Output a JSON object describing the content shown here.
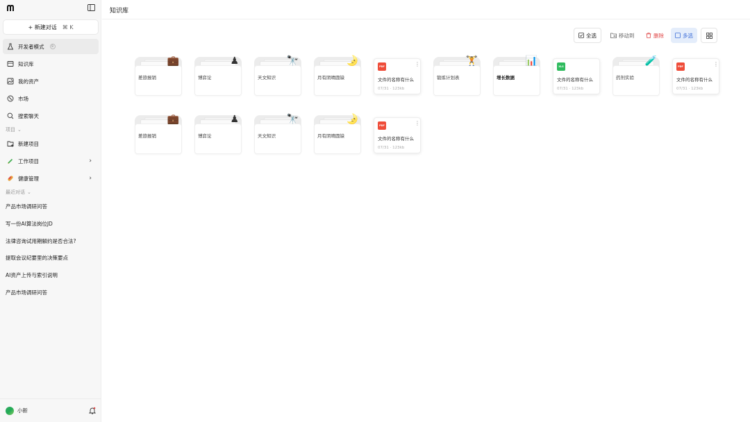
{
  "sidebar": {
    "new_chat": {
      "label": "+ 新建对话",
      "shortcut": "⌘  K"
    },
    "nav": [
      {
        "label": "开发者模式",
        "icon": "flask-icon",
        "badge": "8"
      },
      {
        "label": "知识库",
        "icon": "book-icon"
      },
      {
        "label": "我的资产",
        "icon": "image-icon"
      },
      {
        "label": "市场",
        "icon": "compass-icon"
      },
      {
        "label": "搜索聊天",
        "icon": "search-icon"
      }
    ],
    "projects_label": "项目",
    "new_project": "新建项目",
    "projects": [
      {
        "label": "工作项目",
        "icon": "pencil-icon"
      },
      {
        "label": "健康管理",
        "icon": "pill-icon"
      }
    ],
    "recent_label": "最近对话",
    "recent": [
      "产品市场调研问答",
      "写一份AI算法岗位JD",
      "法律咨询试用期解约是否合法?",
      "提取会议纪要里的决策要点",
      "AI资产上传与索引说明",
      "产品市场调研问答"
    ],
    "user": {
      "name": "小新"
    }
  },
  "header": {
    "title": "知识库"
  },
  "toolbar": {
    "select_all": "全选",
    "move_to": "移动到",
    "delete": "删除",
    "multi_select": "多选"
  },
  "items_row1": [
    {
      "kind": "folder",
      "name": "差旅报销",
      "emoji": "💼"
    },
    {
      "kind": "folder",
      "name": "博弈论",
      "emoji": "♟"
    },
    {
      "kind": "folder",
      "name": "天文知识",
      "emoji": "🔭"
    },
    {
      "kind": "folder",
      "name": "月有阴晴圆缺",
      "emoji": "🌛"
    },
    {
      "kind": "file",
      "type": "PDF",
      "name": "文件的名称有什么",
      "date": "07/31",
      "size": "123kb"
    },
    {
      "kind": "folder",
      "name": "锻炼计划表",
      "emoji": "🏋"
    },
    {
      "kind": "folder",
      "name": "增长数据",
      "emoji": "📊",
      "bold": true
    },
    {
      "kind": "file",
      "type": "XLS",
      "name": "文件的名称有什么",
      "date": "07/31",
      "size": "123kb"
    },
    {
      "kind": "folder",
      "name": "药剂实验",
      "emoji": "🧪"
    },
    {
      "kind": "file",
      "type": "PDF",
      "name": "文件的名称有什么",
      "date": "07/31",
      "size": "123kb"
    }
  ],
  "items_row2": [
    {
      "kind": "folder",
      "name": "差旅报销",
      "emoji": "💼"
    },
    {
      "kind": "folder",
      "name": "博弈论",
      "emoji": "♟"
    },
    {
      "kind": "folder",
      "name": "天文知识",
      "emoji": "🔭"
    },
    {
      "kind": "folder",
      "name": "月有阴晴圆缺",
      "emoji": "🌛"
    },
    {
      "kind": "file",
      "type": "PDF",
      "name": "文件的名称有什么",
      "date": "07/31",
      "size": "123kb"
    }
  ],
  "colors": {
    "accent": "#3f6fd8",
    "danger": "#e04848",
    "pdf": "#ef4d3a",
    "xls": "#2fbb5e"
  }
}
